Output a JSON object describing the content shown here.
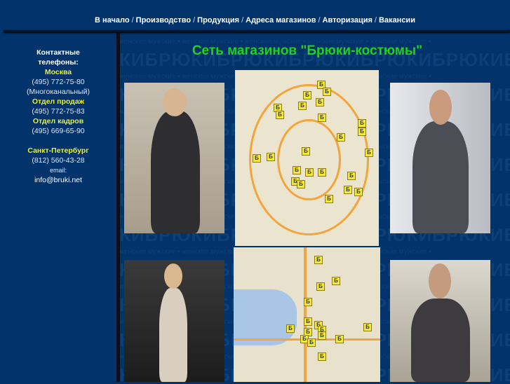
{
  "nav": {
    "items": [
      "В начало",
      "Производство",
      "Продукция",
      "Адреса магазинов",
      "Авторизация",
      "Вакансии"
    ],
    "separator": "/"
  },
  "watermark": {
    "big": "КИБРЮКИБРЮКИБРЮКИБРЮКИБРЮКИБРЮКИБРЮ",
    "small": "женские мужские • женские мужские • женские мужские • женские мужские • женские мужские •"
  },
  "sidebar": {
    "heading1": "Контактные",
    "heading2": "телефоны:",
    "moscow": "Москва",
    "moscow_phone": "(495) 772-75-80",
    "moscow_note": "(Многоканальный)",
    "sales": "Отдел продаж",
    "sales_phone": "(495) 772-75-83",
    "hr": "Отдел кадров",
    "hr_phone": "(495) 669-65-90",
    "spb": "Санкт-Петербург",
    "spb_phone": "(812) 560-43-28",
    "email_label": "email:",
    "email": "info@bruki.net"
  },
  "title": "Сеть магазинов \"Брюки-костюмы\"",
  "map_marker": "Б",
  "colors": {
    "background": "#02336a",
    "title": "#22d022",
    "accent": "#f0f020"
  }
}
